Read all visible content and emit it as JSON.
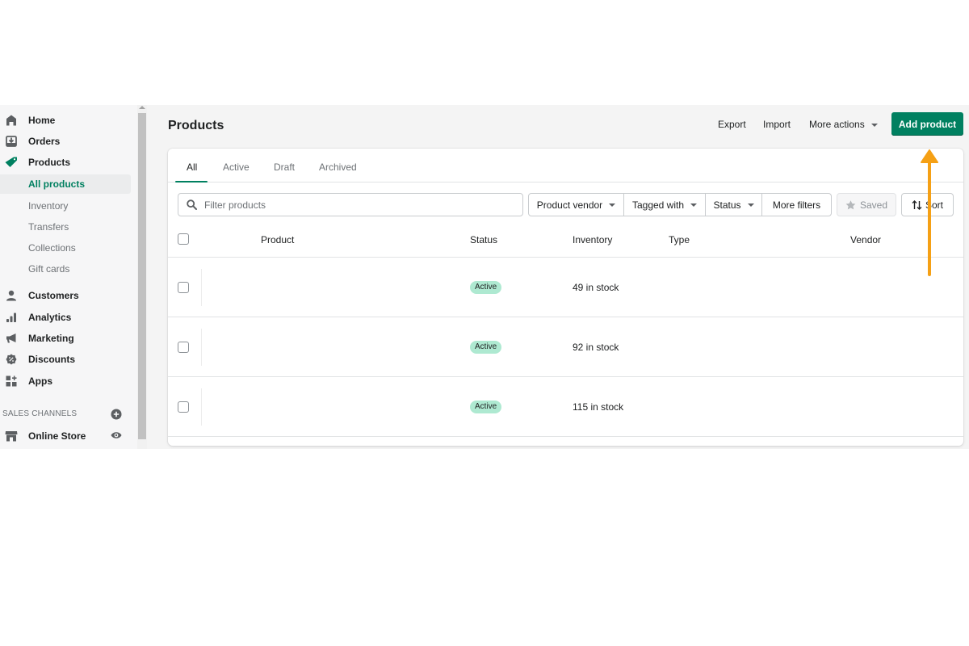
{
  "sidebar": {
    "items": [
      {
        "label": "Home",
        "icon": "home-icon"
      },
      {
        "label": "Orders",
        "icon": "orders-icon"
      },
      {
        "label": "Products",
        "icon": "tag-icon"
      }
    ],
    "sub_items": [
      {
        "label": "All products",
        "selected": true
      },
      {
        "label": "Inventory"
      },
      {
        "label": "Transfers"
      },
      {
        "label": "Collections"
      },
      {
        "label": "Gift cards"
      }
    ],
    "items2": [
      {
        "label": "Customers",
        "icon": "person-icon"
      },
      {
        "label": "Analytics",
        "icon": "bar-chart-icon"
      },
      {
        "label": "Marketing",
        "icon": "megaphone-icon"
      },
      {
        "label": "Discounts",
        "icon": "discount-icon"
      },
      {
        "label": "Apps",
        "icon": "apps-icon"
      }
    ],
    "sales_channels_label": "SALES CHANNELS",
    "channels": [
      {
        "label": "Online Store",
        "icon": "store-icon"
      }
    ]
  },
  "header": {
    "title": "Products",
    "export_label": "Export",
    "import_label": "Import",
    "more_actions_label": "More actions",
    "add_product_label": "Add product"
  },
  "tabs": [
    {
      "label": "All",
      "active": true
    },
    {
      "label": "Active"
    },
    {
      "label": "Draft"
    },
    {
      "label": "Archived"
    }
  ],
  "filters": {
    "search_placeholder": "Filter products",
    "product_vendor": "Product vendor",
    "tagged_with": "Tagged with",
    "status": "Status",
    "more_filters": "More filters",
    "saved": "Saved",
    "sort": "Sort"
  },
  "table": {
    "columns": [
      "Product",
      "Status",
      "Inventory",
      "Type",
      "Vendor"
    ],
    "rows": [
      {
        "product": "",
        "status": "Active",
        "inventory": "49 in stock",
        "type": "",
        "vendor": ""
      },
      {
        "product": "",
        "status": "Active",
        "inventory": "92 in stock",
        "type": "",
        "vendor": ""
      },
      {
        "product": "",
        "status": "Active",
        "inventory": "115 in stock",
        "type": "",
        "vendor": ""
      }
    ]
  },
  "colors": {
    "accent": "#008060",
    "badge_active": "#aee9d1",
    "annotation_arrow": "#f5a015"
  }
}
